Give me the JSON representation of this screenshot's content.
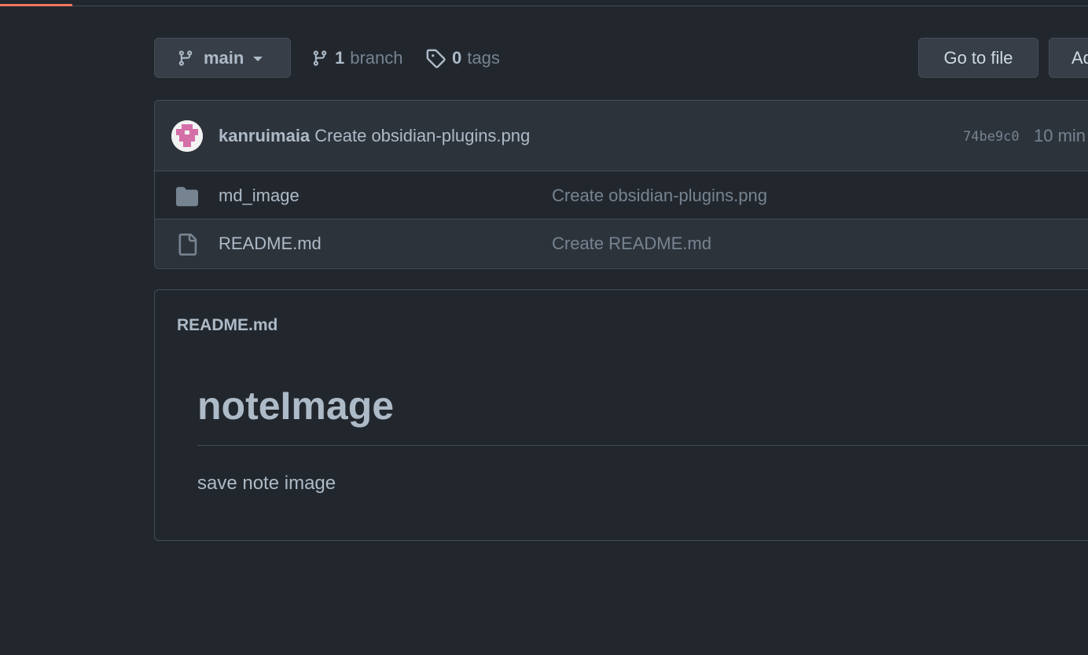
{
  "toolbar": {
    "branch_selector_label": "main",
    "branches_count": "1",
    "branches_text": "branch",
    "tags_count": "0",
    "tags_text": "tags",
    "goto_file_label": "Go to file",
    "add_file_label": "Ad"
  },
  "latest_commit": {
    "author": "kanruimaia",
    "message": "Create obsidian-plugins.png",
    "sha": "74be9c0",
    "time": "10 min"
  },
  "files": [
    {
      "name": "md_image",
      "type": "folder",
      "icon": "folder-icon",
      "message": "Create obsidian-plugins.png"
    },
    {
      "name": "README.md",
      "type": "file",
      "icon": "file-icon",
      "message": "Create README.md"
    }
  ],
  "readme": {
    "filename": "README.md",
    "heading": "noteImage",
    "paragraph": "save note image"
  },
  "colors": {
    "background": "#22272e",
    "row_alt": "#2d333b",
    "border": "#444c56",
    "text": "#adbac7",
    "muted": "#768390",
    "accent_tab": "#ec775c",
    "avatar_pink": "#d46fa8"
  }
}
